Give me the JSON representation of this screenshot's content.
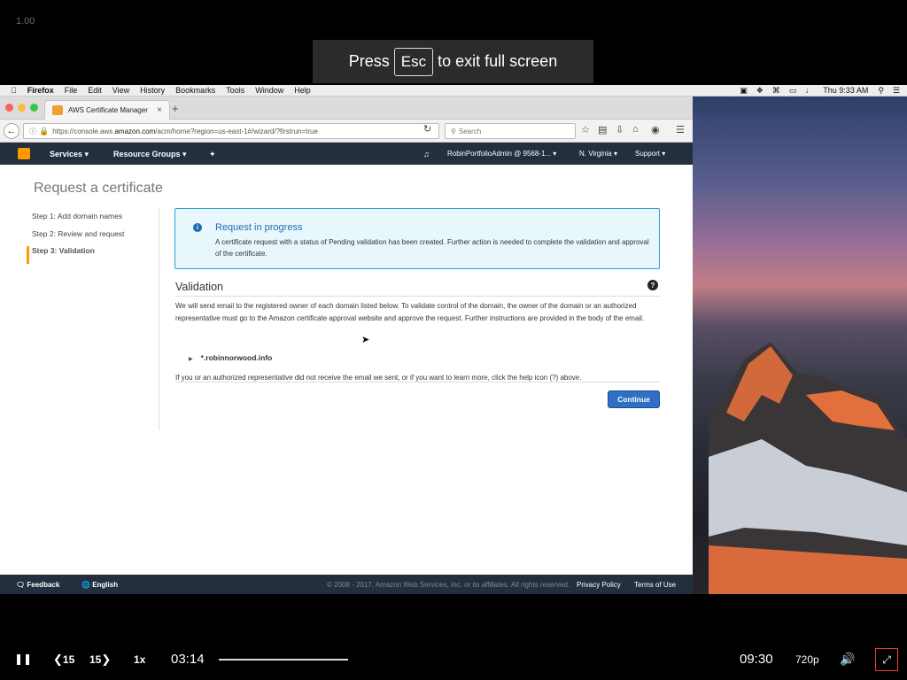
{
  "player": {
    "version_label": "1.00",
    "fullscreen_toast": {
      "prefix": "Press",
      "key": "Esc",
      "suffix": "to exit full screen"
    },
    "controls": {
      "rewind_label": "15",
      "forward_label": "15",
      "speed": "1x",
      "current_time": "03:14",
      "duration": "09:30",
      "quality": "720p"
    }
  },
  "mac_menubar": {
    "app": "Firefox",
    "menus": [
      "File",
      "Edit",
      "View",
      "History",
      "Bookmarks",
      "Tools",
      "Window",
      "Help"
    ],
    "clock": "Thu 9:33 AM"
  },
  "browser": {
    "tab_title": "AWS Certificate Manager",
    "url_prefix": "https://console.aws.",
    "url_host": "amazon.com",
    "url_rest": "/acm/home?region=us-east-1#/wizard/?firstrun=true",
    "search_placeholder": "Search"
  },
  "aws_header": {
    "services": "Services",
    "resource_groups": "Resource Groups",
    "account": "RobinPortfolioAdmin @ 9568-1...",
    "region": "N. Virginia",
    "support": "Support"
  },
  "page": {
    "title": "Request a certificate",
    "steps": [
      "Step 1: Add domain names",
      "Step 2: Review and request",
      "Step 3: Validation"
    ],
    "info": {
      "title": "Request in progress",
      "message": "A certificate request with a status of Pending validation has been created. Further action is needed to complete the validation and approval of the certificate."
    },
    "validation": {
      "title": "Validation",
      "text": "We will send email to the registered owner of each domain listed below. To validate control of the domain, the owner of the domain or an authorized representative must go to the Amazon certificate approval website and approve the request. Further instructions are provided in the body of the email.",
      "domain": "*.robinnorwood.info",
      "help_line": "If you or an authorized representative did not receive the email we sent, or if you want to learn more, click the help icon (?) above."
    },
    "continue_label": "Continue"
  },
  "aws_footer": {
    "feedback": "Feedback",
    "language": "English",
    "copyright": "© 2008 - 2017, Amazon Web Services, Inc. or its affiliates. All rights reserved.",
    "privacy": "Privacy Policy",
    "terms": "Terms of Use"
  }
}
